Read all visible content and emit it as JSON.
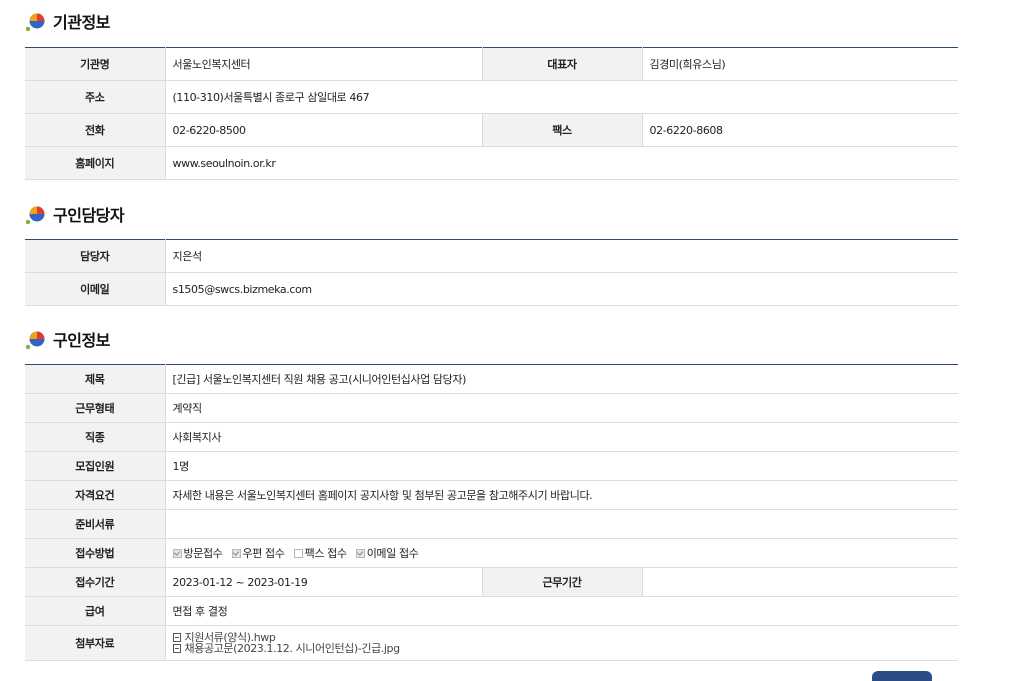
{
  "agency": {
    "title": "기관정보",
    "labels": {
      "name": "기관명",
      "rep": "대표자",
      "address": "주소",
      "phone": "전화",
      "fax": "팩스",
      "homepage": "홈페이지"
    },
    "values": {
      "name": "서울노인복지센터",
      "rep": "김경미(희유스님)",
      "address": "(110-310)서울특별시 종로구 삼일대로 467",
      "phone": "02-6220-8500",
      "fax": "02-6220-8608",
      "homepage": "www.seoulnoin.or.kr"
    }
  },
  "contact": {
    "title": "구인담당자",
    "labels": {
      "manager": "담당자",
      "email": "이메일"
    },
    "values": {
      "manager": "지은석",
      "email": "s1505@swcs.bizmeka.com"
    }
  },
  "job": {
    "title": "구인정보",
    "labels": {
      "subject": "제목",
      "work_type": "근무형태",
      "category": "직종",
      "headcount": "모집인원",
      "qualification": "자격요건",
      "documents": "준비서류",
      "method": "접수방법",
      "period": "접수기간",
      "work_period": "근무기간",
      "salary": "급여",
      "attachments": "첨부자료"
    },
    "values": {
      "subject": "[긴급] 서울노인복지센터 직원 채용 공고(시니어인턴십사업 담당자)",
      "work_type": "계약직",
      "category": "사회복지사",
      "headcount": "1명",
      "qualification": "자세한 내용은 서울노인복지센터 홈페이지 공지사항 및 첨부된 공고문을 참고해주시기 바랍니다.",
      "documents": "",
      "method_options": [
        {
          "label": "방문접수",
          "checked": true
        },
        {
          "label": "우편 접수",
          "checked": true
        },
        {
          "label": "팩스 접수",
          "checked": false
        },
        {
          "label": "이메일 접수",
          "checked": true
        }
      ],
      "period": "2023-01-12 ~ 2023-01-19",
      "work_period": "",
      "salary": "면접 후 결정",
      "attachments": [
        "지원서류(양식).hwp",
        "채용공고문(2023.1.12. 시니어인턴십)-긴급.jpg"
      ]
    }
  },
  "colors": {
    "accent_line": "#2f4a6a",
    "header_bg": "#f2f2f2",
    "button": "#2a4d86"
  }
}
